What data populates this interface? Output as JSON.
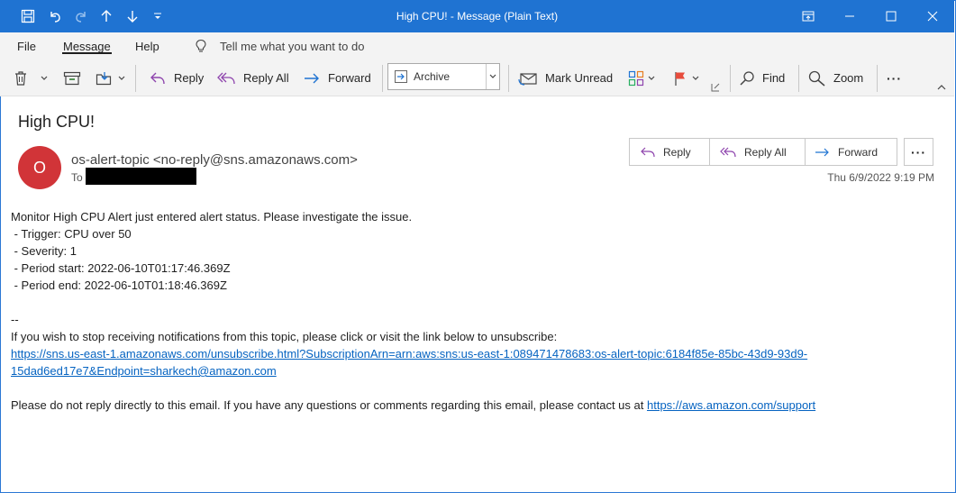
{
  "window": {
    "title": "High CPU!  -  Message (Plain Text)"
  },
  "menu": {
    "tabs": [
      "File",
      "Message",
      "Help"
    ],
    "tell_me": "Tell me what you want to do"
  },
  "ribbon": {
    "reply": "Reply",
    "reply_all": "Reply All",
    "forward": "Forward",
    "archive": "Archive",
    "mark_unread": "Mark Unread",
    "find": "Find",
    "zoom": "Zoom",
    "more": "···"
  },
  "message": {
    "subject": "High CPU!",
    "avatar_initial": "O",
    "avatar_color": "#d13438",
    "sender": "os-alert-topic <no-reply@sns.amazonaws.com>",
    "to_label": "To",
    "date": "Thu 6/9/2022 9:19 PM",
    "actions": {
      "reply": "Reply",
      "reply_all": "Reply All",
      "forward": "Forward"
    },
    "more": "···",
    "body": {
      "line1": "Monitor High CPU Alert just entered alert status. Please investigate the issue.",
      "line2": " - Trigger: CPU over 50",
      "line3": " - Severity: 1",
      "line4": " - Period start: 2022-06-10T01:17:46.369Z",
      "line5": " - Period end: 2022-06-10T01:18:46.369Z",
      "sig": "--",
      "unsub_text": "If you wish to stop receiving notifications from this topic, please click or visit the link below to unsubscribe:",
      "unsub_link_1": "https://sns.us-east-1.amazonaws.com/unsubscribe.html?SubscriptionArn=arn:aws:sns:us-east-1:089471478683:os-alert-topic:6184f85e-85bc-43d9-93d9-",
      "unsub_link_2": "15dad6ed17e7&Endpoint=sharkech@amazon.com",
      "footer_text": "Please do not reply directly to this email. If you have any questions or comments regarding this email, please contact us at ",
      "footer_link": "https://aws.amazon.com/support"
    }
  }
}
